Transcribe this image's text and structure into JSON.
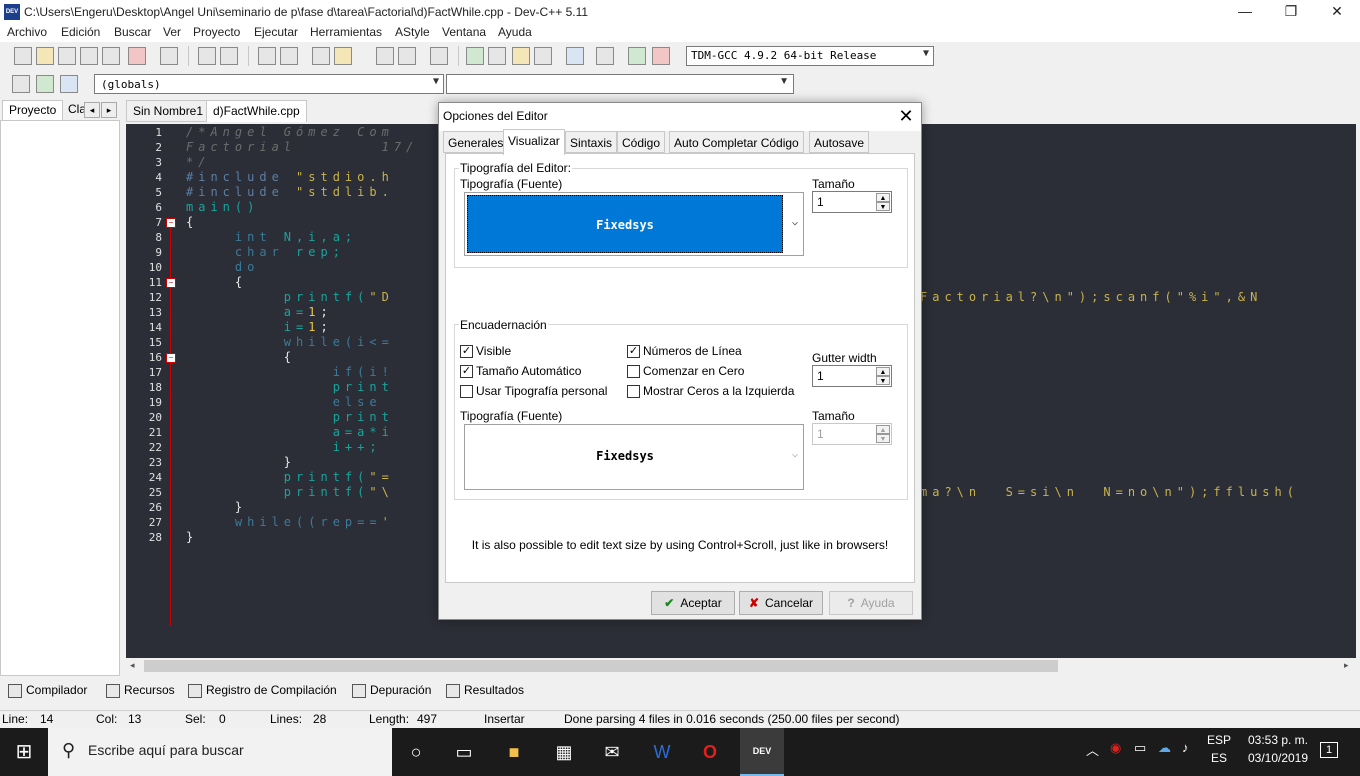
{
  "window": {
    "title": "C:\\Users\\Engeru\\Desktop\\Angel Uni\\seminario de p\\fase d\\tarea\\Factorial\\d)FactWhile.cpp - Dev-C++ 5.11",
    "app_icon": "DEV",
    "minimize_glyph": "—",
    "maximize_glyph": "❐",
    "close_glyph": "✕"
  },
  "menu": [
    "Archivo",
    "Edición",
    "Buscar",
    "Ver",
    "Proyecto",
    "Ejecutar",
    "Herramientas",
    "AStyle",
    "Ventana",
    "Ayuda"
  ],
  "toolbar": {
    "compiler": "TDM-GCC 4.9.2 64-bit Release",
    "globals": "(globals)",
    "members": ""
  },
  "left_tabs": {
    "proyecto": "Proyecto",
    "clases": "Cla",
    "prev": "◂",
    "next": "▸"
  },
  "file_tabs": [
    "Sin Nombre1",
    "d)FactWhile.cpp"
  ],
  "editor": {
    "line_numbers": [
      "1",
      "2",
      "3",
      "4",
      "5",
      "6",
      "7",
      "8",
      "9",
      "10",
      "11",
      "12",
      "13",
      "14",
      "15",
      "16",
      "17",
      "18",
      "19",
      "20",
      "21",
      "22",
      "23",
      "24",
      "25",
      "26",
      "27",
      "28"
    ],
    "lines": {
      "l1": "/*Angel Gómez Com",
      "l2": "Factorial       17/",
      "l3": "*/",
      "l4a": "#include ",
      "l4b": "\"stdio.h",
      "l5a": "#include ",
      "l5b": "\"stdlib.",
      "l6": "main()",
      "l7": "{",
      "l8a": "    int ",
      "l8b": "N,i,a;",
      "l9a": "    char ",
      "l9b": "rep;",
      "l10": "    do",
      "l11": "    {",
      "l12a": "        printf(",
      "l12b": "\"D",
      "l12r": "Factorial?\\n\");scanf(\"%i\",&N",
      "l13a": "        a=",
      "l13b": "1",
      "l13c": ";",
      "l14a": "        i=",
      "l14b": "1",
      "l14c": ";",
      "l15": "        while(i<=",
      "l16": "        {",
      "l17": "            if(i!",
      "l18": "            print",
      "l19": "            else",
      "l20": "            print",
      "l21": "            a=a*i",
      "l22": "            i++;",
      "l23": "        }",
      "l24a": "        printf(",
      "l24b": "\"=",
      "l25a": "        printf(",
      "l25b": "\"\\",
      "l25r": "ma?\\n  S=si\\n  N=no\\n\");fflush(",
      "l26": "    }",
      "l27a": "    while((rep==",
      "l27b": "'",
      "l28": "}"
    }
  },
  "bottom_tabs": [
    "Compilador",
    "Recursos",
    "Registro de Compilación",
    "Depuración",
    "Resultados"
  ],
  "status": {
    "line_label": "Line:",
    "line_value": "14",
    "col_label": "Col:",
    "col_value": "13",
    "sel_label": "Sel:",
    "sel_value": "0",
    "lines_label": "Lines:",
    "lines_value": "28",
    "length_label": "Length:",
    "length_value": "497",
    "mode": "Insertar",
    "message": "Done parsing 4 files in 0.016 seconds (250.00 files per second)"
  },
  "dialog": {
    "title": "Opciones del Editor",
    "close_glyph": "✕",
    "tabs": [
      "Generales",
      "Visualizar",
      "Sintaxis",
      "Código",
      "Auto Completar Código",
      "Autosave"
    ],
    "active_tab": "Visualizar",
    "editor_font": {
      "group_label": "Tipografía del Editor:",
      "font_label": "Tipografía (Fuente)",
      "font_value": "Fixedsys",
      "size_label": "Tamaño",
      "size_value": "1"
    },
    "gutter": {
      "group_label": "Encuadernación",
      "visible": {
        "label": "Visible",
        "checked": true
      },
      "auto_size": {
        "label": "Tamaño Automático",
        "checked": true
      },
      "custom_font": {
        "label": "Usar Tipografía personal",
        "checked": false
      },
      "line_numbers": {
        "label": "Números de Línea",
        "checked": true
      },
      "start_zero": {
        "label": "Comenzar en Cero",
        "checked": false
      },
      "leading_zeros": {
        "label": "Mostrar Ceros a la Izquierda",
        "checked": false
      },
      "width_label": "Gutter width",
      "width_value": "1",
      "font_label": "Tipografía (Fuente)",
      "font_value": "Fixedsys",
      "size_label": "Tamaño",
      "size_value": "1"
    },
    "hint": "It is also possible to edit text size by using Control+Scroll, just like in browsers!",
    "buttons": {
      "ok": "Aceptar",
      "cancel": "Cancelar",
      "help": "Ayuda"
    }
  },
  "taskbar": {
    "start_glyph": "⊞",
    "search_placeholder": "Escribe aquí para buscar",
    "search_glyph": "⚲",
    "cortana_glyph": "○",
    "lang_top": "ESP",
    "lang_bottom": "ES",
    "time": "03:53 p. m.",
    "date": "03/10/2019",
    "notification_count": "1",
    "tray_up_glyph": "︿"
  },
  "colors": {
    "accent": "#0078d7",
    "editor_bg": "#2b2e36",
    "taskbar_bg": "#1b1b1b"
  }
}
